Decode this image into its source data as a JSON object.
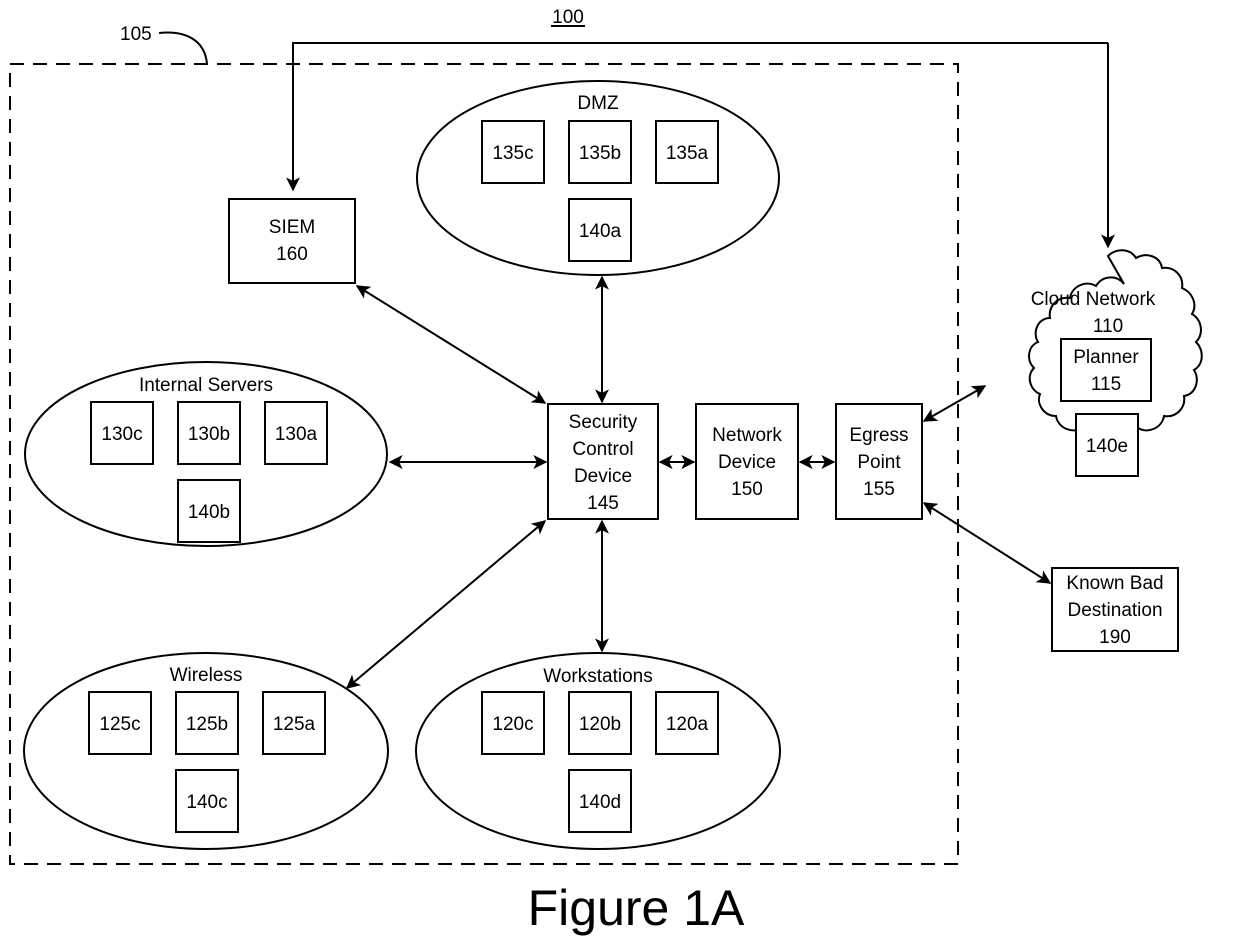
{
  "figure": {
    "ref_system": "100",
    "ref_enterprise": "105",
    "caption": "Figure 1A"
  },
  "zones": {
    "dmz": {
      "title": "DMZ",
      "nodes": [
        "135c",
        "135b",
        "135a",
        "140a"
      ]
    },
    "internal_servers": {
      "title": "Internal Servers",
      "nodes": [
        "130c",
        "130b",
        "130a",
        "140b"
      ]
    },
    "wireless": {
      "title": "Wireless",
      "nodes": [
        "125c",
        "125b",
        "125a",
        "140c"
      ]
    },
    "workstations": {
      "title": "Workstations",
      "nodes": [
        "120c",
        "120b",
        "120a",
        "140d"
      ]
    }
  },
  "devices": {
    "siem": {
      "line1": "SIEM",
      "line2": "160"
    },
    "security_control": {
      "line1": "Security",
      "line2": "Control",
      "line3": "Device",
      "line4": "145"
    },
    "network_device": {
      "line1": "Network",
      "line2": "Device",
      "line3": "150"
    },
    "egress_point": {
      "line1": "Egress",
      "line2": "Point",
      "line3": "155"
    },
    "known_bad": {
      "line1": "Known Bad",
      "line2": "Destination",
      "line3": "190"
    }
  },
  "cloud": {
    "line1": "Cloud Network",
    "line2": "110",
    "planner": {
      "line1": "Planner",
      "line2": "115"
    },
    "node": "140e"
  }
}
